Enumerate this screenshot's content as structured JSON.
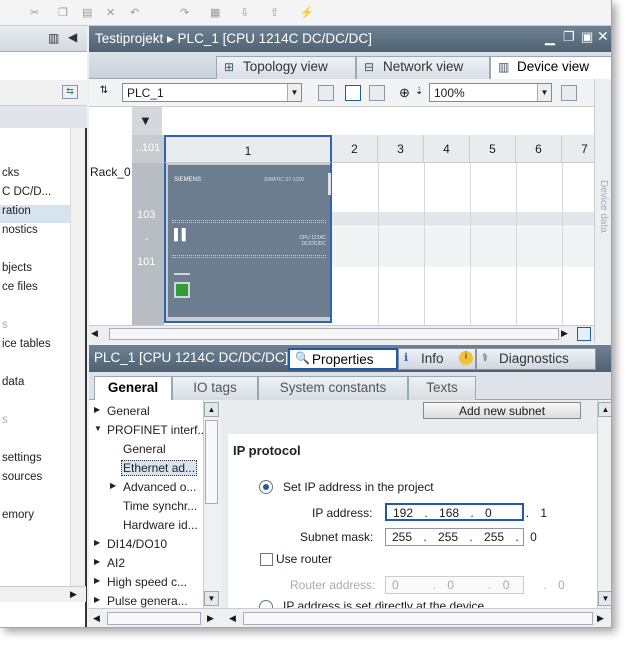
{
  "window": {
    "title": "Testiprojekt  ▸  PLC_1 [CPU 1214C DC/DC/DC]"
  },
  "view_tabs": [
    {
      "label": "Topology view"
    },
    {
      "label": "Network view"
    },
    {
      "label": "Device view"
    }
  ],
  "left_panel": {
    "items": [
      "cks",
      "C DC/D...",
      "ration",
      "nostics",
      "bjects",
      "ce files",
      "s",
      "ice tables",
      "data",
      "s",
      "settings",
      "sources",
      "emory"
    ]
  },
  "device_toolbar": {
    "device_select": "PLC_1",
    "zoom": "100%"
  },
  "rack": {
    "label": "Rack_0",
    "left_header": "..101",
    "slots": [
      "1",
      "2",
      "3",
      "4",
      "5",
      "6",
      "7"
    ],
    "left_numbers": [
      "103",
      "-",
      "101"
    ],
    "plc_brand": "SIEMENS",
    "plc_model": "SIMATIC S7-1200",
    "plc_sub": "CPU 1214C DC/DC/DC"
  },
  "side_label": "Device data",
  "properties_bar": {
    "title": "PLC_1 [CPU 1214C DC/DC/DC]",
    "tabs": [
      {
        "label": "Properties"
      },
      {
        "label": "Info"
      },
      {
        "label": "Diagnostics"
      }
    ]
  },
  "sub_tabs": [
    {
      "label": "General"
    },
    {
      "label": "IO tags"
    },
    {
      "label": "System constants"
    },
    {
      "label": "Texts"
    }
  ],
  "nav": {
    "items": [
      {
        "label": "General"
      },
      {
        "label": "PROFINET interf..."
      },
      {
        "label": "General"
      },
      {
        "label": "Ethernet ad..."
      },
      {
        "label": "Advanced o..."
      },
      {
        "label": "Time synchr..."
      },
      {
        "label": "Hardware id..."
      },
      {
        "label": "DI14/DO10"
      },
      {
        "label": "AI2"
      },
      {
        "label": "High speed c..."
      },
      {
        "label": "Pulse genera..."
      }
    ]
  },
  "ip_section": {
    "add_subnet": "Add new subnet",
    "heading": "IP protocol",
    "opt_project": "Set IP address in the project",
    "ip_label": "IP address:",
    "ip_value": "192 . 168 . 0   . 1",
    "mask_label": "Subnet mask:",
    "mask_value": "255 . 255 . 255 . 0",
    "use_router": "Use router",
    "router_label": "Router address:",
    "router_value": "0   . 0   . 0   . 0",
    "opt_device": "IP address is set directly at the device"
  },
  "colors": {
    "title_bar": "#5a6e80",
    "accent": "#1e5aa8",
    "plc_body": "#6b7d8e",
    "port": "#2e9d3a"
  }
}
